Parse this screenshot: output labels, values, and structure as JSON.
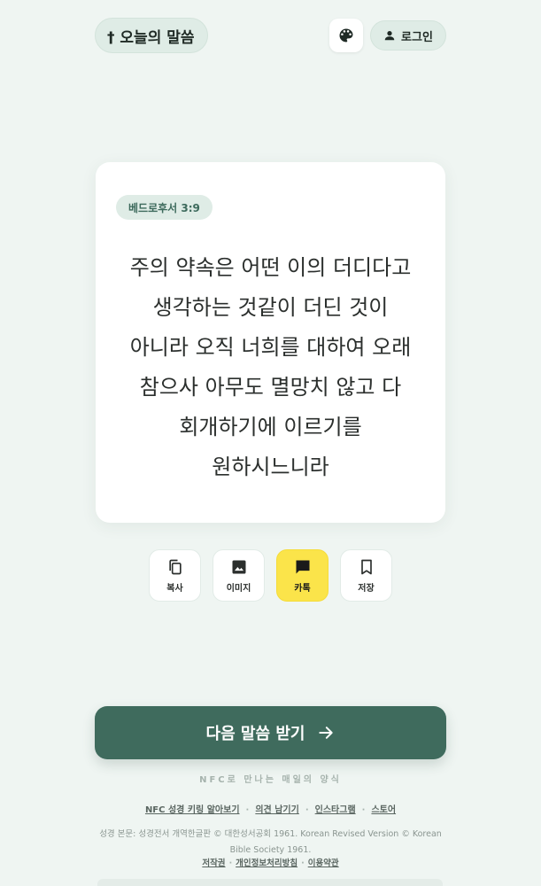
{
  "header": {
    "brand": "† 오늘의 말씀",
    "palette_icon": "palette-icon",
    "login_label": "로그인",
    "login_icon": "person-icon"
  },
  "verse_card": {
    "reference": "베드로후서 3:9",
    "lines": [
      "주의 약속은 어떤 이의 더디다고",
      "생각하는 것같이 더딘 것이",
      "아니라 오직 너희를 대하여 오래",
      "참으사 아무도 멸망치 않고 다",
      "회개하기에 이르기를",
      "원하시느니라"
    ]
  },
  "actions": [
    {
      "label": "복사",
      "icon": "copy-icon"
    },
    {
      "label": "이미지",
      "icon": "image-icon"
    },
    {
      "label": "카톡",
      "icon": "chat-icon"
    },
    {
      "label": "저장",
      "icon": "bookmark-icon"
    }
  ],
  "next_button": {
    "label": "다음 말씀 받기",
    "icon": "arrow-right-icon"
  },
  "tagline": "NFC로 만나는 매일의 양식",
  "footer": {
    "links": [
      "NFC 성경 키링 알아보기",
      "의견 남기기",
      "인스타그램",
      "스토어"
    ],
    "copyright": "성경 본문: 성경전서 개역한글판 © 대한성서공회 1961. Korean Revised Version © Korean Bible Society 1961.",
    "legal": [
      "저작권",
      "개인정보처리방침",
      "이용약관"
    ]
  },
  "colors": {
    "background": "#eff5f2",
    "primary": "#3f6b5d",
    "badge_bg": "#dfece6",
    "kakao": "#fbe44a"
  }
}
